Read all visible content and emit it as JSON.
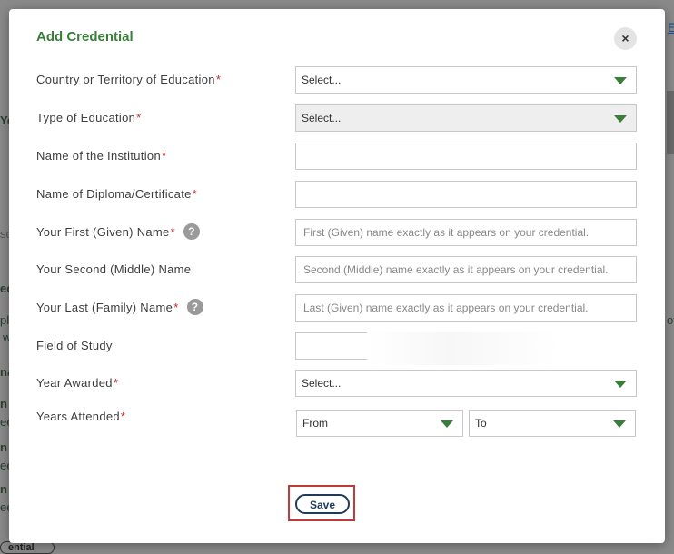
{
  "backdrop": {
    "top_link": "E",
    "fragments": [
      "Yo",
      "sc",
      "ec",
      "pl",
      "w",
      "na",
      "n c",
      "ee",
      "n r",
      "ee",
      "n l",
      "ee",
      "of"
    ],
    "bottom_button": "ential"
  },
  "modal": {
    "title": "Add Credential",
    "close_glyph": "×"
  },
  "fields": {
    "country": {
      "label": "Country or Territory of Education",
      "value": "Select..."
    },
    "education_type": {
      "label": "Type of Education",
      "value": "Select..."
    },
    "institution": {
      "label": "Name of the Institution",
      "value": ""
    },
    "diploma": {
      "label": "Name of Diploma/Certificate",
      "value": ""
    },
    "first_name": {
      "label": "Your First (Given) Name",
      "placeholder": "First (Given) name exactly as it appears on your credential."
    },
    "middle_name": {
      "label": "Your Second (Middle) Name",
      "placeholder": "Second (Middle) name exactly as it appears on your credential."
    },
    "last_name": {
      "label": "Your Last (Family) Name",
      "placeholder": "Last (Given) name exactly as it appears on your credential."
    },
    "field_of_study": {
      "label": "Field of Study",
      "value": ""
    },
    "year_awarded": {
      "label": "Year Awarded",
      "value": "Select..."
    },
    "years_attended": {
      "label": "Years Attended",
      "from": "From",
      "to": "To"
    }
  },
  "required_mark": "*",
  "help_glyph": "?",
  "save_label": "Save",
  "colors": {
    "accent": "#3b7d3b",
    "required": "#c62828",
    "highlight": "#c0393b",
    "button_border": "#1f3b5a"
  }
}
